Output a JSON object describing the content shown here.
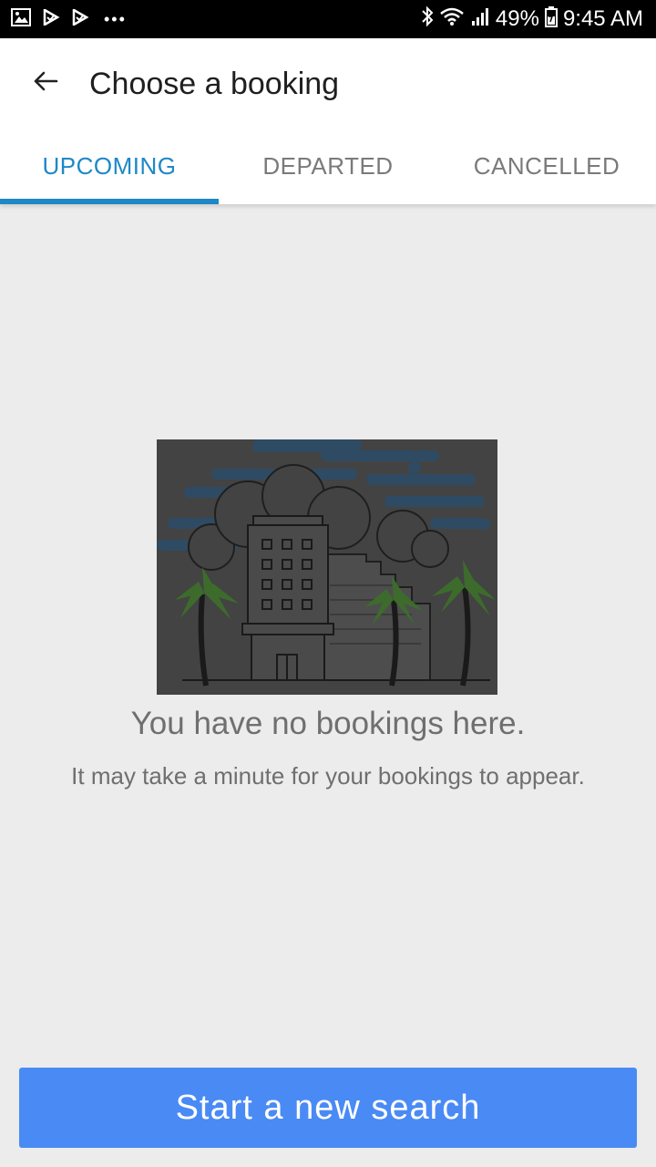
{
  "status_bar": {
    "battery": "49%",
    "time": "9:45 AM",
    "icons": [
      "gallery-icon",
      "check-flag-icon",
      "check-flag-icon",
      "more-dots-icon",
      "bluetooth-icon",
      "wifi-icon",
      "signal-icon",
      "battery-icon"
    ]
  },
  "app_bar": {
    "back_icon": "arrow-left-icon",
    "title": "Choose a booking"
  },
  "tabs": [
    {
      "label": "UPCOMING",
      "active": true
    },
    {
      "label": "DEPARTED",
      "active": false
    },
    {
      "label": "CANCELLED",
      "active": false
    }
  ],
  "empty_state": {
    "title": "You have no bookings here.",
    "subtitle": "It may take a minute for your bookings to appear."
  },
  "actions": {
    "new_search_label": "Start a new search"
  },
  "colors": {
    "accent": "#1e88c7",
    "button": "#4a8af4",
    "background": "#ececec"
  }
}
